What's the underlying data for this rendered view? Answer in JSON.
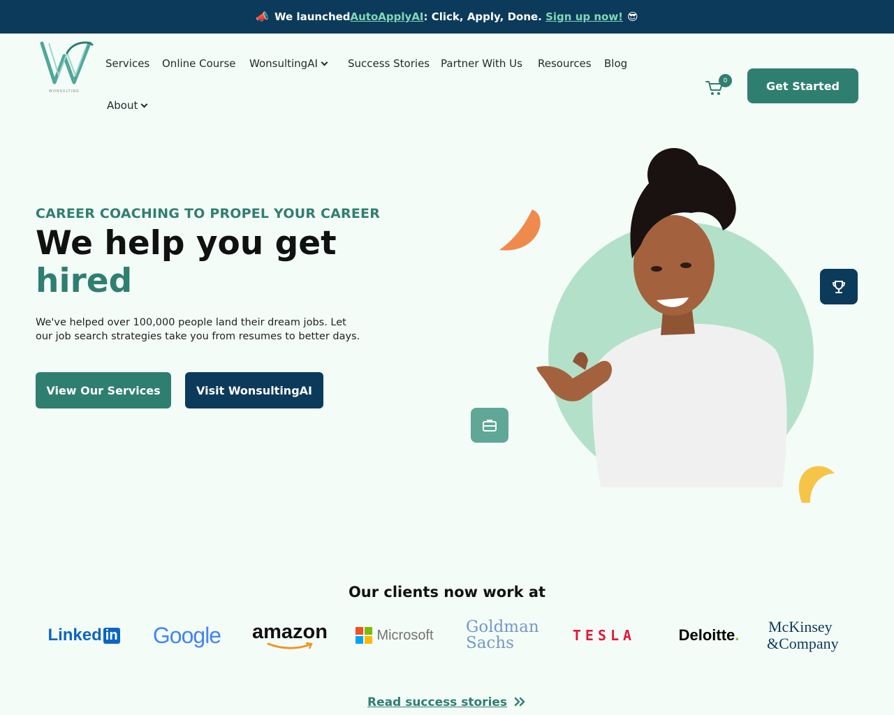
{
  "announcement": {
    "emoji_left": "📣",
    "prefix": "We launched ",
    "product_link": "AutoApplyAI",
    "middle": ": Click, Apply, Done. ",
    "signup_link": "Sign up now!",
    "emoji_right": "😎"
  },
  "brand": {
    "logo_text": "WONSULTING",
    "accent_color": "#2f7f71",
    "navy_color": "#0c3a5b"
  },
  "nav": {
    "items": [
      {
        "label": "Services"
      },
      {
        "label": "Online Course"
      },
      {
        "label": "WonsultingAI",
        "dropdown": true
      },
      {
        "label": "Success Stories"
      },
      {
        "label": "Partner With Us"
      },
      {
        "label": "Resources"
      },
      {
        "label": "Blog"
      },
      {
        "label": "About",
        "dropdown": true
      }
    ],
    "cart_count": "0",
    "cta": "Get Started"
  },
  "hero": {
    "eyebrow": "CAREER COACHING TO PROPEL YOUR CAREER",
    "title_line1": "We help you get",
    "title_line2": "hired",
    "lead": "We've helped over 100,000 people land their dream jobs. Let our job search strategies take you from resumes to better days.",
    "primary_button": "View Our Services",
    "secondary_button": "Visit WonsultingAI"
  },
  "clients": {
    "title": "Our clients now work at",
    "logos": [
      "LinkedIn",
      "Google",
      "amazon",
      "Microsoft",
      "Goldman Sachs",
      "TESLA",
      "Deloitte.",
      "McKinsey & Company"
    ],
    "linkedin_word": "Linked",
    "linkedin_in": "in",
    "google": "Google",
    "amazon": "amazon",
    "microsoft": "Microsoft",
    "goldman_1": "Goldman",
    "goldman_2": "Sachs",
    "tesla": "TESLA",
    "deloitte": "Deloitte",
    "deloitte_dot": ".",
    "mckinsey_1": "McKinsey",
    "mckinsey_2": "&Company"
  },
  "footer_link": {
    "label": "Read success stories",
    "icon": "double-chevron-right-icon"
  }
}
